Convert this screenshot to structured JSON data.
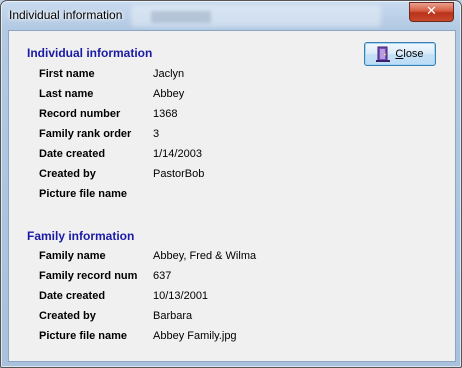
{
  "window": {
    "title": "Individual information",
    "close_glyph": "✕"
  },
  "close_button": {
    "label": "Close",
    "icon": "door-exit-icon"
  },
  "individual": {
    "heading": "Individual information",
    "rows": [
      {
        "label": "First name",
        "value": "Jaclyn"
      },
      {
        "label": "Last name",
        "value": "Abbey"
      },
      {
        "label": "Record number",
        "value": "1368"
      },
      {
        "label": "Family rank order",
        "value": "3"
      },
      {
        "label": "Date created",
        "value": "1/14/2003"
      },
      {
        "label": "Created by",
        "value": "PastorBob"
      },
      {
        "label": "Picture file name",
        "value": ""
      }
    ]
  },
  "family": {
    "heading": "Family information",
    "rows": [
      {
        "label": "Family name",
        "value": "Abbey, Fred & Wilma"
      },
      {
        "label": "Family record num",
        "value": "637"
      },
      {
        "label": "Date created",
        "value": "10/13/2001"
      },
      {
        "label": "Created by",
        "value": "Barbara"
      },
      {
        "label": "Picture file name",
        "value": "Abbey Family.jpg"
      }
    ]
  },
  "colors": {
    "heading": "#1a1aa6",
    "client_bg": "#f0f0f0"
  }
}
